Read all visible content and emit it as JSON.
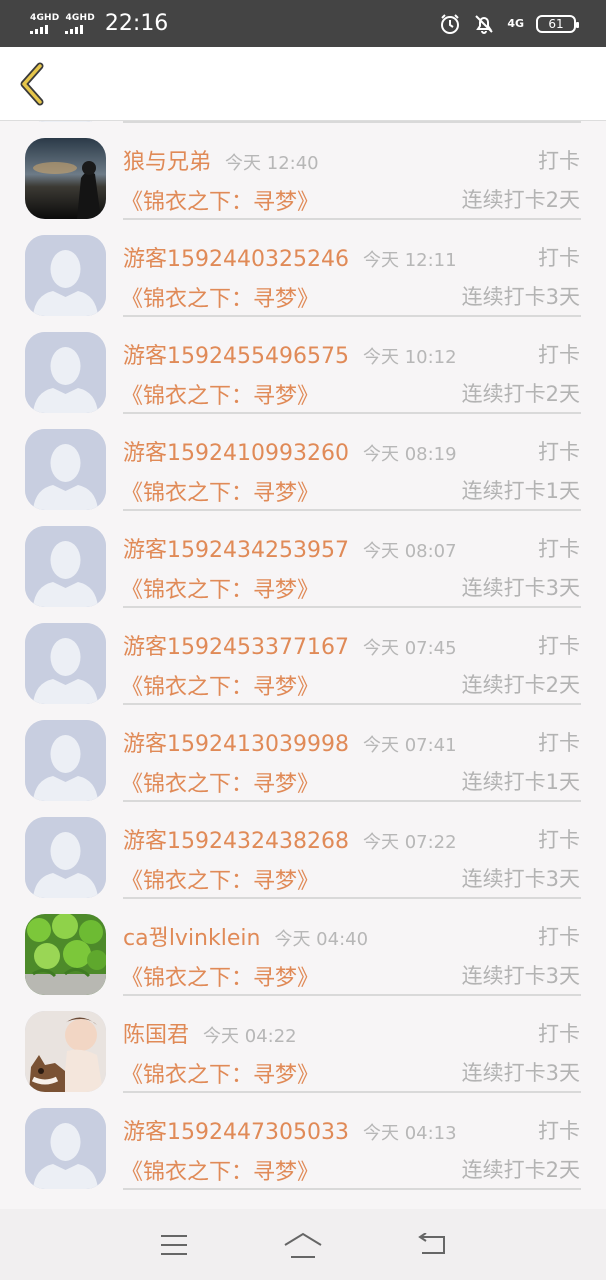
{
  "status_bar": {
    "net1": "4GHD",
    "net2": "4GHD",
    "time": "22:16",
    "lte": "4G",
    "battery": "61"
  },
  "header": {
    "back_icon": "chevron-left-icon"
  },
  "colors": {
    "accent": "#e08a57",
    "muted": "#b3b3b3",
    "back": "#e6c64b"
  },
  "list": {
    "items": [
      {
        "name": "",
        "time": "",
        "action": "",
        "title": "",
        "streak": "",
        "avatar": "placeholder"
      },
      {
        "name": "狼与兄弟",
        "time": "今天 12:40",
        "action": "打卡",
        "title": "《锦衣之下：寻梦》",
        "streak": "连续打卡2天",
        "avatar": "dark-photo"
      },
      {
        "name": "游客1592440325246",
        "time": "今天 12:11",
        "action": "打卡",
        "title": "《锦衣之下：寻梦》",
        "streak": "连续打卡3天",
        "avatar": "placeholder"
      },
      {
        "name": "游客1592455496575",
        "time": "今天 10:12",
        "action": "打卡",
        "title": "《锦衣之下：寻梦》",
        "streak": "连续打卡2天",
        "avatar": "placeholder"
      },
      {
        "name": "游客1592410993260",
        "time": "今天 08:19",
        "action": "打卡",
        "title": "《锦衣之下：寻梦》",
        "streak": "连续打卡1天",
        "avatar": "placeholder"
      },
      {
        "name": "游客1592434253957",
        "time": "今天 08:07",
        "action": "打卡",
        "title": "《锦衣之下：寻梦》",
        "streak": "连续打卡3天",
        "avatar": "placeholder"
      },
      {
        "name": "游客1592453377167",
        "time": "今天 07:45",
        "action": "打卡",
        "title": "《锦衣之下：寻梦》",
        "streak": "连续打卡2天",
        "avatar": "placeholder"
      },
      {
        "name": "游客1592413039998",
        "time": "今天 07:41",
        "action": "打卡",
        "title": "《锦衣之下：寻梦》",
        "streak": "连续打卡1天",
        "avatar": "placeholder"
      },
      {
        "name": "游客1592432438268",
        "time": "今天 07:22",
        "action": "打卡",
        "title": "《锦衣之下：寻梦》",
        "streak": "连续打卡3天",
        "avatar": "placeholder"
      },
      {
        "name": "ca꿩lvinklein",
        "time": "今天 04:40",
        "action": "打卡",
        "title": "《锦衣之下：寻梦》",
        "streak": "连续打卡3天",
        "avatar": "clover-photo"
      },
      {
        "name": "陈国君",
        "time": "今天 04:22",
        "action": "打卡",
        "title": "《锦衣之下：寻梦》",
        "streak": "连续打卡3天",
        "avatar": "child-dog-photo"
      },
      {
        "name": "游客1592447305033",
        "time": "今天 04:13",
        "action": "打卡",
        "title": "《锦衣之下：寻梦》",
        "streak": "连续打卡2天",
        "avatar": "placeholder"
      }
    ]
  },
  "bottom_nav": {
    "menu_icon": "menu-icon",
    "home_icon": "home-icon",
    "back_icon": "back-arrow-icon"
  }
}
